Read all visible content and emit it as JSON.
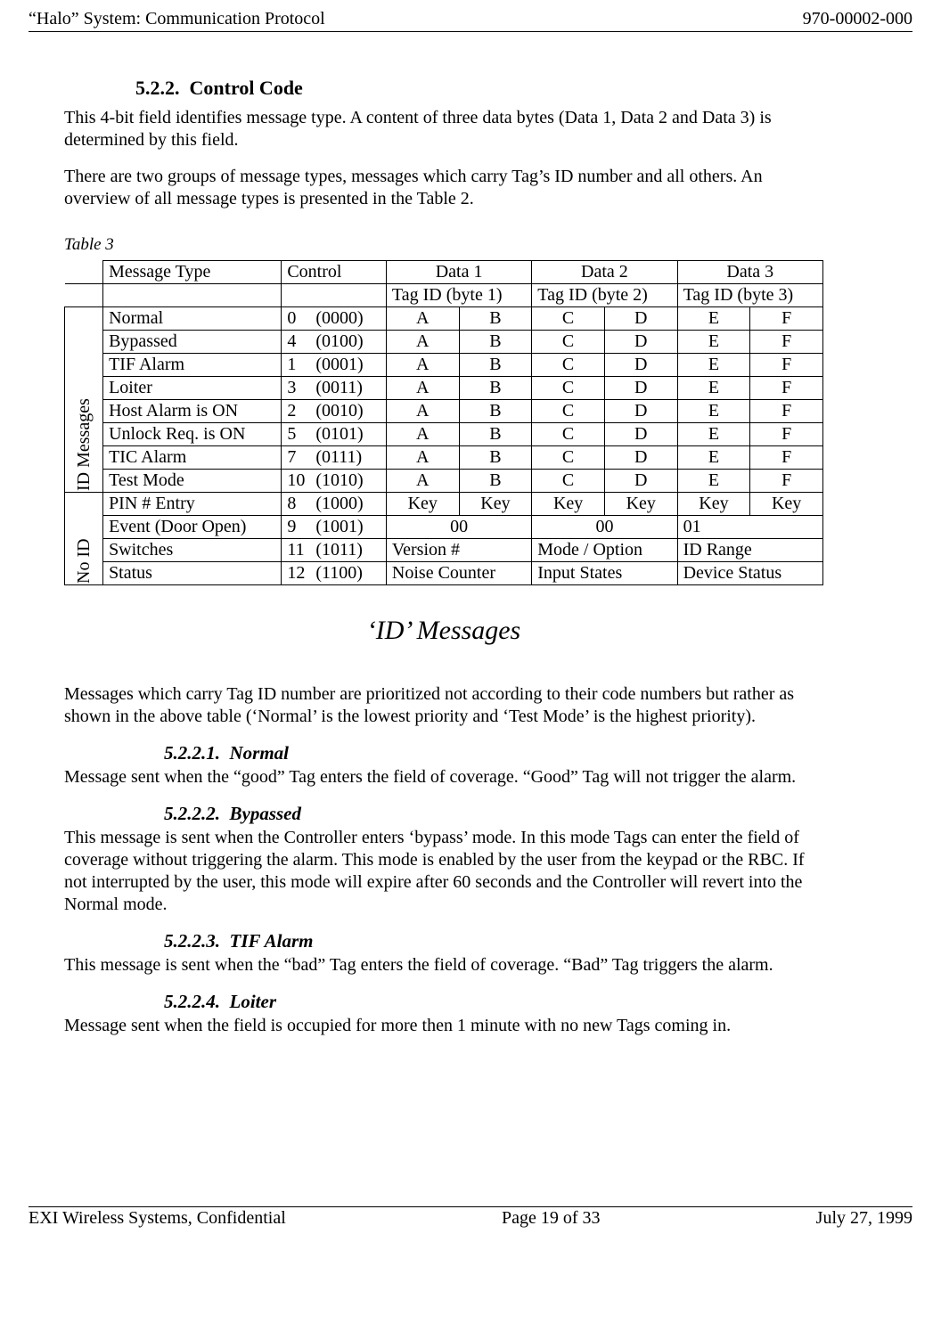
{
  "header": {
    "left": "“Halo” System: Communication Protocol",
    "right": "970-00002-000"
  },
  "sec522": {
    "num": "5.2.2.",
    "title": "Control Code",
    "p1": "This 4-bit field identifies message type. A content of three data bytes (Data 1, Data 2 and Data 3) is determined by this field.",
    "p2": "There are two groups of message types, messages which carry Tag’s ID number and all others. An overview of all message types is presented in the Table 2."
  },
  "table_caption": "Table 3",
  "cols": {
    "msg": "Message Type",
    "ctrl": "Control",
    "d1": "Data 1",
    "d2": "Data 2",
    "d3": "Data 3",
    "tid1": "Tag ID (byte 1)",
    "tid2": "Tag ID (byte 2)",
    "tid3": "Tag ID (byte 3)"
  },
  "group1_label": "ID Messages",
  "group2_label": "No ID",
  "id_rows": [
    {
      "name": "Normal",
      "num": "0",
      "bits": "(0000)",
      "a": "A",
      "b": "B",
      "c": "C",
      "d": "D",
      "e": "E",
      "f": "F"
    },
    {
      "name": "Bypassed",
      "num": "4",
      "bits": "(0100)",
      "a": "A",
      "b": "B",
      "c": "C",
      "d": "D",
      "e": "E",
      "f": "F"
    },
    {
      "name": "TIF Alarm",
      "num": "1",
      "bits": "(0001)",
      "a": "A",
      "b": "B",
      "c": "C",
      "d": "D",
      "e": "E",
      "f": "F"
    },
    {
      "name": "Loiter",
      "num": "3",
      "bits": "(0011)",
      "a": "A",
      "b": "B",
      "c": "C",
      "d": "D",
      "e": "E",
      "f": "F"
    },
    {
      "name": "Host Alarm is ON",
      "num": "2",
      "bits": "(0010)",
      "a": "A",
      "b": "B",
      "c": "C",
      "d": "D",
      "e": "E",
      "f": "F"
    },
    {
      "name": "Unlock Req. is ON",
      "num": "5",
      "bits": "(0101)",
      "a": "A",
      "b": "B",
      "c": "C",
      "d": "D",
      "e": "E",
      "f": "F"
    },
    {
      "name": "TIC Alarm",
      "num": "7",
      "bits": "(0111)",
      "a": "A",
      "b": "B",
      "c": "C",
      "d": "D",
      "e": "E",
      "f": "F"
    },
    {
      "name": "Test Mode",
      "num": "10",
      "bits": "(1010)",
      "a": "A",
      "b": "B",
      "c": "C",
      "d": "D",
      "e": "E",
      "f": "F"
    }
  ],
  "no_id_rows": {
    "pin": {
      "name": "PIN # Entry",
      "num": "8",
      "bits": "(1000)",
      "c1a": "Key",
      "c1b": "Key",
      "c2a": "Key",
      "c2b": "Key",
      "c3a": "Key",
      "c3b": "Key"
    },
    "event": {
      "name": "Event (Door Open)",
      "num": "9",
      "bits": "(1001)",
      "d1": "00",
      "d2": "00",
      "d3": "01"
    },
    "switches": {
      "name": "Switches",
      "num": "11",
      "bits": "(1011)",
      "d1": "Version #",
      "d2": "Mode / Option",
      "d3": "ID Range"
    },
    "status": {
      "name": "Status",
      "num": "12",
      "bits": "(1100)",
      "d1": "Noise Counter",
      "d2": "Input States",
      "d3": "Device Status"
    }
  },
  "id_heading": "‘ID’ Messages",
  "id_para": "Messages which carry Tag ID number are prioritized not according to their code numbers but rather as shown in the above table (‘Normal’ is the lowest priority and ‘Test Mode’ is the highest priority).",
  "s1": {
    "num": "5.2.2.1.",
    "title": "Normal",
    "body": "Message sent when the “good” Tag enters the field of coverage. “Good” Tag will not trigger the alarm."
  },
  "s2": {
    "num": "5.2.2.2.",
    "title": "Bypassed",
    "body": "This message is sent when the Controller enters ‘bypass’ mode. In this mode Tags can enter the field of coverage without triggering the alarm. This mode is enabled by the user from the keypad or the RBC. If not interrupted by the user, this mode will expire after 60 seconds and the Controller will revert into the Normal mode."
  },
  "s3": {
    "num": "5.2.2.3.",
    "title": "TIF Alarm",
    "body": "This message is sent when the “bad” Tag enters the field of coverage. “Bad” Tag triggers the alarm."
  },
  "s4": {
    "num": "5.2.2.4.",
    "title": "Loiter",
    "body": "Message sent when the field is occupied for more then 1 minute with no new Tags coming in."
  },
  "footer": {
    "left": "EXI Wireless Systems, Confidential",
    "center": "Page 19 of 33",
    "right": "July 27, 1999"
  }
}
